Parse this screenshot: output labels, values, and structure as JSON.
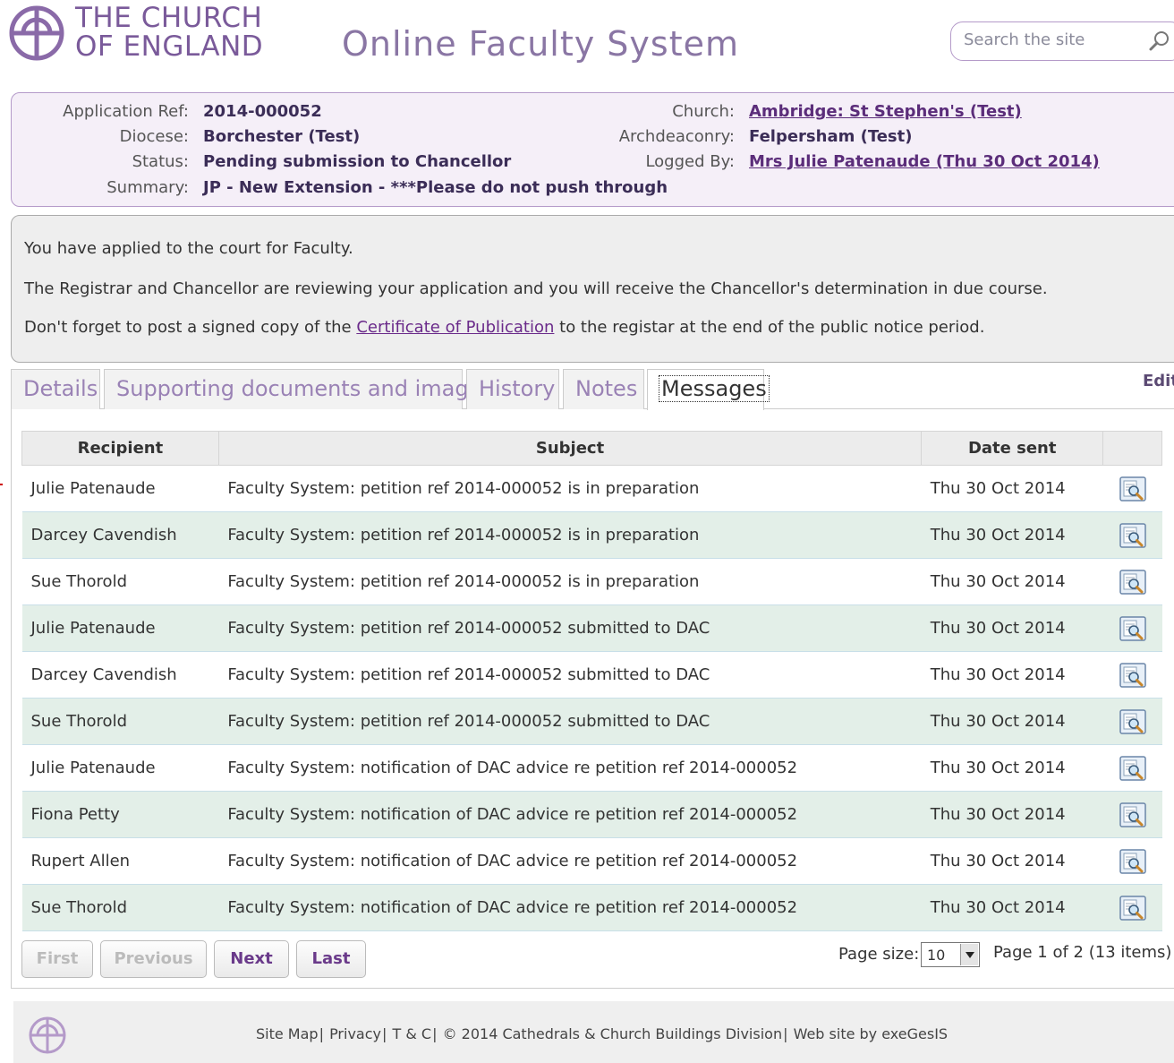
{
  "header": {
    "logo_line1": "THE CHURCH",
    "logo_line2": "OF ENGLAND",
    "site_title": "Online Faculty System",
    "search_placeholder": "Search the site"
  },
  "application": {
    "ref_label": "Application Ref:",
    "ref": "2014-000052",
    "diocese_label": "Diocese:",
    "diocese": "Borchester (Test)",
    "status_label": "Status:",
    "status": "Pending submission to Chancellor",
    "summary_label": "Summary:",
    "summary": "JP - New Extension - ***Please do not push through",
    "church_label": "Church:",
    "church": "Ambridge: St Stephen's (Test)",
    "archdeaconry_label": "Archdeaconry:",
    "archdeaconry": "Felpersham (Test)",
    "logged_by_label": "Logged By:",
    "logged_by": "Mrs Julie Patenaude (Thu 30 Oct 2014)"
  },
  "status_panel": {
    "line1": "You have applied to the court for Faculty.",
    "line2": "The Registrar and Chancellor are reviewing your application and you will receive the Chancellor's determination in due course.",
    "line3_pre": "Don't forget to post a signed copy of the ",
    "line3_link": "Certificate of Publication",
    "line3_post": " to the registar at the end of the public notice period."
  },
  "tabs": [
    {
      "label": "Details"
    },
    {
      "label": "Supporting documents and images"
    },
    {
      "label": "History"
    },
    {
      "label": "Notes"
    },
    {
      "label": "Messages"
    }
  ],
  "edit_label": "Edit",
  "messages": {
    "columns": {
      "recipient": "Recipient",
      "subject": "Subject",
      "date": "Date sent"
    },
    "rows": [
      {
        "recipient": "Julie Patenaude",
        "subject": "Faculty System: petition ref 2014-000052 is in preparation",
        "date": "Thu 30 Oct 2014"
      },
      {
        "recipient": "Darcey Cavendish",
        "subject": "Faculty System: petition ref 2014-000052 is in preparation",
        "date": "Thu 30 Oct 2014"
      },
      {
        "recipient": "Sue Thorold",
        "subject": "Faculty System: petition ref 2014-000052 is in preparation",
        "date": "Thu 30 Oct 2014"
      },
      {
        "recipient": "Julie Patenaude",
        "subject": "Faculty System: petition ref 2014-000052 submitted to DAC",
        "date": "Thu 30 Oct 2014"
      },
      {
        "recipient": "Darcey Cavendish",
        "subject": "Faculty System: petition ref 2014-000052 submitted to DAC",
        "date": "Thu 30 Oct 2014"
      },
      {
        "recipient": "Sue Thorold",
        "subject": "Faculty System: petition ref 2014-000052 submitted to DAC",
        "date": "Thu 30 Oct 2014"
      },
      {
        "recipient": "Julie Patenaude",
        "subject": "Faculty System: notification of DAC advice re petition ref 2014-000052",
        "date": "Thu 30 Oct 2014"
      },
      {
        "recipient": "Fiona Petty",
        "subject": "Faculty System: notification of DAC advice re petition ref 2014-000052",
        "date": "Thu 30 Oct 2014"
      },
      {
        "recipient": "Rupert Allen",
        "subject": "Faculty System: notification of DAC advice re petition ref 2014-000052",
        "date": "Thu 30 Oct 2014"
      },
      {
        "recipient": "Sue Thorold",
        "subject": "Faculty System: notification of DAC advice re petition ref 2014-000052",
        "date": "Thu 30 Oct 2014"
      }
    ]
  },
  "pager": {
    "first": "First",
    "previous": "Previous",
    "next": "Next",
    "last": "Last",
    "page_size_label": "Page size:",
    "page_size": "10",
    "page_info": "Page 1 of 2 (13 items)"
  },
  "footer": {
    "links": [
      "Site Map",
      "Privacy",
      "T & C",
      "© 2014 Cathedrals & Church Buildings Division",
      "Web site by exeGesIS"
    ]
  },
  "colors": {
    "brand_purple": "#7a5a9a",
    "info_bg": "#f5eff8",
    "row_alt": "#e3efe8"
  }
}
